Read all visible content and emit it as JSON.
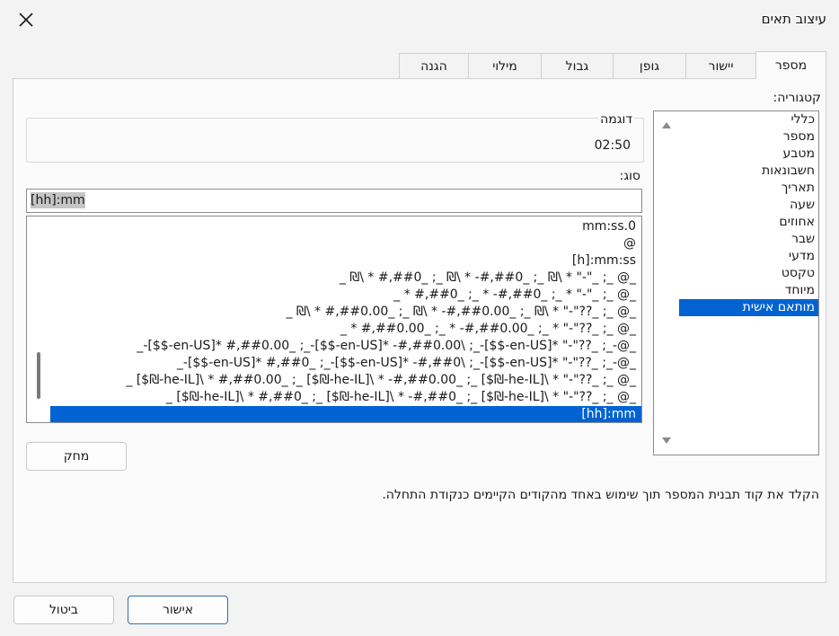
{
  "window": {
    "title": "עיצוב תאים"
  },
  "tabs": [
    {
      "label": "מספר",
      "active": true
    },
    {
      "label": "יישור"
    },
    {
      "label": "גופן"
    },
    {
      "label": "גבול"
    },
    {
      "label": "מילוי"
    },
    {
      "label": "הגנה"
    }
  ],
  "category": {
    "label": "קטגוריה:",
    "items": [
      "כללי",
      "מספר",
      "מטבע",
      "חשבונאות",
      "תאריך",
      "שעה",
      "אחוזים",
      "שבר",
      "מדעי",
      "טקסט",
      "מיוחד",
      "מותאם אישית"
    ],
    "selected": "מותאם אישית"
  },
  "sample": {
    "label": "דוגמה",
    "value": "02:50"
  },
  "type": {
    "label": "סוג:",
    "value": "[hh]:mm"
  },
  "formats": [
    "mm:ss.0",
    "@",
    "[h]:mm:ss",
    "_ ₪\\ * #,##0_ ;_ ₪\\ * -#,##0_ ;_ ₪\\ * \"-\"_ ;_ @_",
    "_ * #,##0_ ;_ * -#,##0_ ;_ * \"-\"_ ;_ @_",
    "_ ₪\\ * #,##0.00_ ;_ ₪\\ * -#,##0.00_ ;_ ₪\\ * \"-\"??_ ;_ @_",
    "_ * #,##0.00_ ;_ * -#,##0.00_ ;_ * \"-\"??_ ;_ @_",
    "_-[$$-en-US]* #,##0.00_ ;_-[$$-en-US]* -#,##0.00\\ ;_-[$$-en-US]* \"-\"??_ ;_-@_",
    "_-[$$-en-US]* #,##0_ ;_-[$$-en-US]* -#,##0\\ ;_-[$$-en-US]* \"-\"??_ ;_-@_",
    "_ [$₪-he-IL]\\ * #,##0.00_ ;_ [$₪-he-IL]\\ * -#,##0.00_ ;_ [$₪-he-IL]\\ * \"-\"??_ ;_ @_",
    "_ [$₪-he-IL]\\ * #,##0_ ;_ [$₪-he-IL]\\ * -#,##0_ ;_ [$₪-he-IL]\\ * \"-\"??_ ;_ @_",
    "[hh]:mm"
  ],
  "buttons": {
    "delete": "מחק",
    "ok": "אישור",
    "cancel": "ביטול"
  },
  "hint": "הקלד את קוד תבנית המספר תוך שימוש באחד מהקודים הקיימים כנקודת התחלה.",
  "icons": {
    "close": "close-icon",
    "scroll_up": "chevron-up-icon",
    "scroll_down": "chevron-down-icon"
  }
}
